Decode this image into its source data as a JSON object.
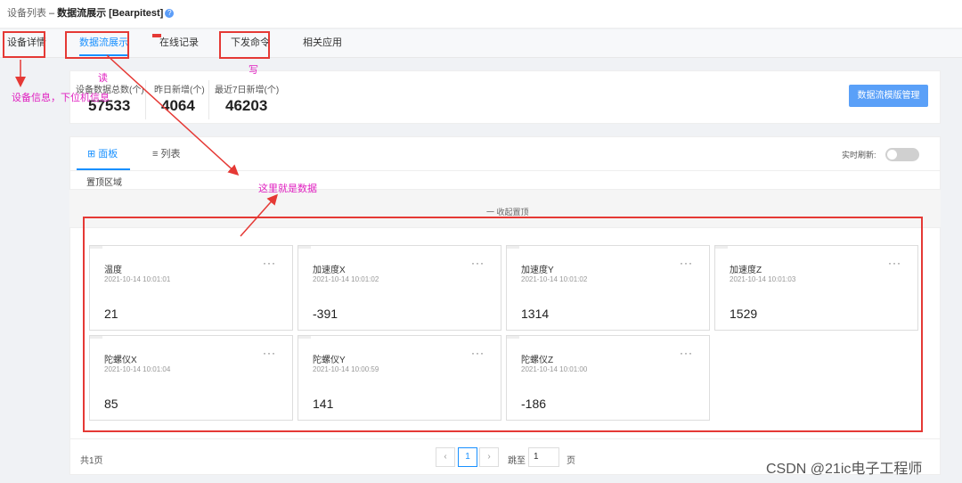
{
  "breadcrumb": {
    "parent": "设备列表",
    "separator": "–",
    "title": "数据流展示 [Bearpitest]",
    "help": "?"
  },
  "tabs": [
    {
      "label": "设备详情"
    },
    {
      "label": "数据流展示",
      "active": true
    },
    {
      "label": "在线记录"
    },
    {
      "label": "下发命令"
    },
    {
      "label": "相关应用"
    }
  ],
  "stats": [
    {
      "label": "设备数据总数(个)",
      "value": "57533"
    },
    {
      "label": "昨日新增(个)",
      "value": "4064"
    },
    {
      "label": "最近7日新增(个)",
      "value": "46203"
    }
  ],
  "template_button": "数据流模版管理",
  "view_tabs": [
    {
      "icon": "grid-icon",
      "label": "面板",
      "active": true
    },
    {
      "icon": "list-icon",
      "label": "列表"
    }
  ],
  "realtime_label": "实时刷新:",
  "realtime_on": false,
  "pinned_label": "置顶区域",
  "collapse_label": "一 收起置顶",
  "tiles": [
    {
      "name": "温度",
      "time": "2021-10-14 10:01:01",
      "value": "21"
    },
    {
      "name": "加速度X",
      "time": "2021-10-14 10:01:02",
      "value": "-391"
    },
    {
      "name": "加速度Y",
      "time": "2021-10-14 10:01:02",
      "value": "1314"
    },
    {
      "name": "加速度Z",
      "time": "2021-10-14 10:01:03",
      "value": "1529"
    },
    {
      "name": "陀螺仪X",
      "time": "2021-10-14 10:01:04",
      "value": "85"
    },
    {
      "name": "陀螺仪Y",
      "time": "2021-10-14 10:00:59",
      "value": "141"
    },
    {
      "name": "陀螺仪Z",
      "time": "2021-10-14 10:01:00",
      "value": "-186"
    }
  ],
  "tile_menu": "···",
  "pagination": {
    "total": "共1页",
    "prev": "‹",
    "current": "1",
    "next": "›",
    "jump_label": "跳至",
    "jump_value": "1",
    "page_suffix": "页"
  },
  "annotations": {
    "read": "读",
    "write": "写",
    "device_info": "设备信息，下位机信息",
    "data_here": "这里就是数据"
  },
  "watermark": "CSDN @21ic电子工程师"
}
